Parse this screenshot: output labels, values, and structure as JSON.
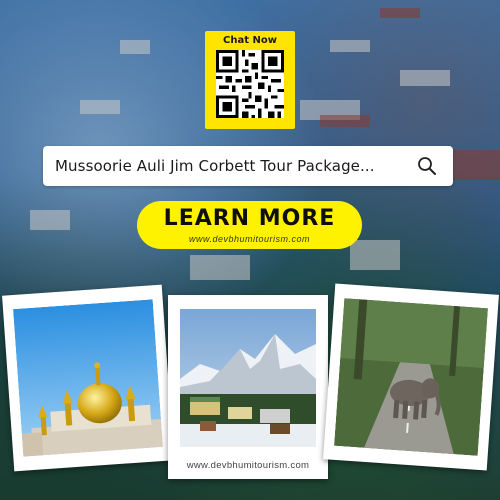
{
  "qr": {
    "title": "Chat Now"
  },
  "search": {
    "text": "Mussoorie Auli Jim Corbett Tour Package..."
  },
  "cta": {
    "label": "LEARN MORE",
    "url": "www.devbhumitourism.com"
  },
  "photos": [
    {
      "name": "golden-dome-temple",
      "caption": ""
    },
    {
      "name": "snowy-mountain-village",
      "caption": "www.devbhumitourism.com"
    },
    {
      "name": "elephant-on-road",
      "caption": ""
    }
  ],
  "colors": {
    "accent": "#fff200",
    "qr_bg": "#ffe400"
  }
}
